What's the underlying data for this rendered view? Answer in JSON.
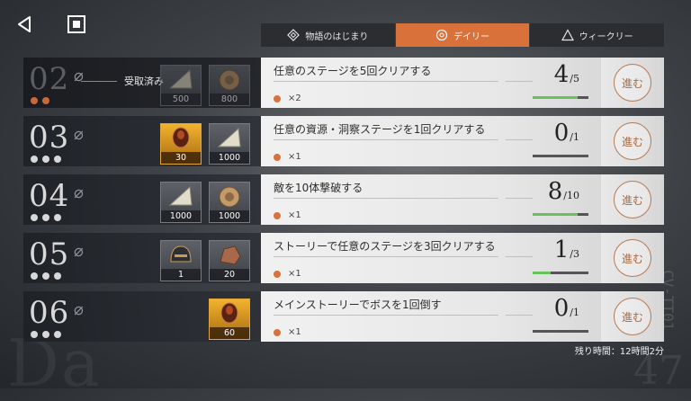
{
  "tabs": [
    {
      "label": "物語のはじまり",
      "icon": "diamond-icon"
    },
    {
      "label": "デイリー",
      "icon": "circle-icon"
    },
    {
      "label": "ウィークリー",
      "icon": "triangle-icon"
    }
  ],
  "background": {
    "watermark_left": "Da",
    "watermark_right": "47",
    "vertical_text": "CV-TT01"
  },
  "tasks": [
    {
      "num": "02",
      "claimed": "受取済み",
      "rewards": [
        {
          "count": "500",
          "type": "silver"
        },
        {
          "count": "800",
          "type": "silver"
        }
      ],
      "text": "任意のステージを5回クリアする",
      "mult": "×2",
      "progress_cur": "4",
      "progress_tot": "5",
      "go": "進む",
      "progress_fraction": 0.8
    },
    {
      "num": "03",
      "rewards": [
        {
          "count": "30",
          "type": "gold"
        },
        {
          "count": "1000",
          "type": "silver"
        }
      ],
      "text": "任意の資源・洞察ステージを1回クリアする",
      "mult": "×1",
      "progress_cur": "0",
      "progress_tot": "1",
      "go": "進む",
      "progress_fraction": 0
    },
    {
      "num": "04",
      "rewards": [
        {
          "count": "1000",
          "type": "silver"
        },
        {
          "count": "1000",
          "type": "silver"
        }
      ],
      "text": "敵を10体撃破する",
      "mult": "×1",
      "progress_cur": "8",
      "progress_tot": "10",
      "go": "進む",
      "progress_fraction": 0.8
    },
    {
      "num": "05",
      "rewards": [
        {
          "count": "1",
          "type": "silver"
        },
        {
          "count": "20",
          "type": "silver"
        }
      ],
      "text": "ストーリーで任意のステージを3回クリアする",
      "mult": "×1",
      "progress_cur": "1",
      "progress_tot": "3",
      "go": "進む",
      "progress_fraction": 0.33
    },
    {
      "num": "06",
      "rewards": [
        {
          "count": "60",
          "type": "gold"
        }
      ],
      "text": "メインストーリーでボスを1回倒す",
      "mult": "×1",
      "progress_cur": "0",
      "progress_tot": "1",
      "go": "進む",
      "progress_fraction": 0
    }
  ],
  "timer": "残り時間：12時間2分",
  "colors": {
    "accent": "#d9713b",
    "progress_green": "#67c25a"
  }
}
